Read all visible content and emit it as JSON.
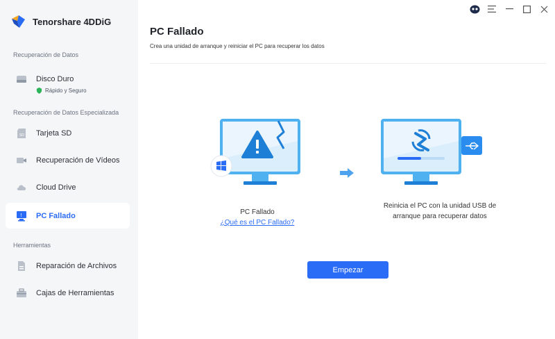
{
  "app": {
    "name": "Tenorshare 4DDiG"
  },
  "sidebar": {
    "sections": [
      {
        "label": "Recuperación de Datos"
      },
      {
        "label": "Recuperación de Datos Especializada"
      },
      {
        "label": "Herramientas"
      }
    ],
    "items": [
      {
        "label": "Disco Duro",
        "sub": "Rápido y Seguro",
        "icon": "hard-drive-icon"
      },
      {
        "label": "Tarjeta SD",
        "icon": "sd-card-icon"
      },
      {
        "label": "Recuperación de Vídeos",
        "icon": "video-icon"
      },
      {
        "label": "Cloud Drive",
        "icon": "cloud-icon"
      },
      {
        "label": "PC Fallado",
        "icon": "crashed-pc-icon",
        "active": true
      },
      {
        "label": "Reparación de Archivos",
        "icon": "file-repair-icon"
      },
      {
        "label": "Cajas de Herramientas",
        "icon": "toolbox-icon"
      }
    ]
  },
  "main": {
    "title": "PC Fallado",
    "subtitle": "Crea una unidad de arranque y reiniciar el PC para recuperar los datos",
    "step1": {
      "label": "PC Fallado",
      "link": "¿Qué es el PC Fallado?"
    },
    "step2": {
      "line1": "Reinicia el PC con la unidad USB de",
      "line2": "arranque para recuperar datos"
    },
    "start_button": "Empezar"
  },
  "colors": {
    "accent": "#2b6cf6",
    "sidebar_bg": "#f5f6f8",
    "monitor": "#4fb1f0",
    "monitor_screen": "#dbeefc"
  }
}
